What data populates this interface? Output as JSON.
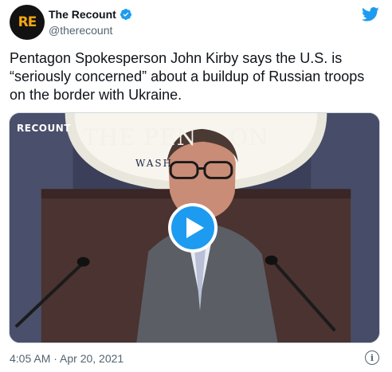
{
  "account": {
    "display_name": "The Recount",
    "handle": "@therecount",
    "avatar_text": "RE",
    "verified": true
  },
  "tweet": {
    "text": "Pentagon Spokesperson John Kirby says the U.S. is “seriously concerned” about a buildup of Russian troops on the border with Ukraine.",
    "timestamp": "4:05 AM · Apr 20, 2021"
  },
  "media": {
    "type": "video",
    "watermark": "RECOUNT",
    "seal_text_a": "THE PEN",
    "seal_text_b": "ON",
    "seal_text_sub": "WASH"
  },
  "colors": {
    "accent": "#1d9bf0",
    "text_primary": "#0f1419",
    "text_secondary": "#536471",
    "avatar_bg": "#121212",
    "avatar_fg": "#f3a712"
  },
  "icons": {
    "verified": "verified-badge-icon",
    "brand": "twitter-bird-icon",
    "play": "play-icon",
    "info": "info-icon"
  }
}
